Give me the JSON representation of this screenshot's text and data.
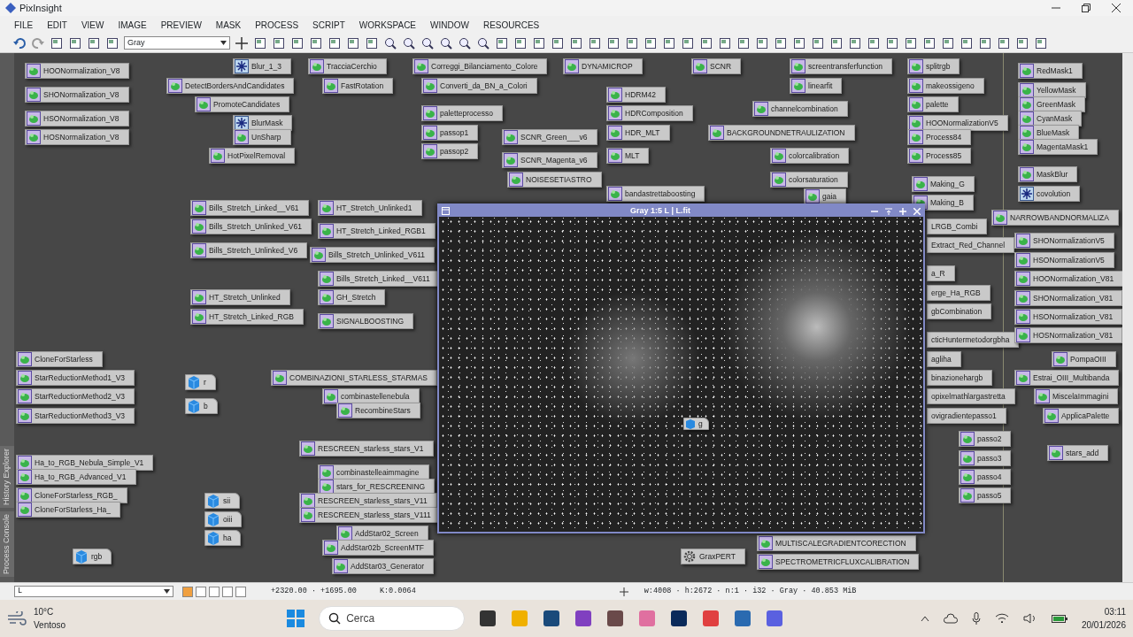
{
  "window": {
    "title": "PixInsight"
  },
  "menu": [
    "FILE",
    "EDIT",
    "VIEW",
    "IMAGE",
    "PREVIEW",
    "MASK",
    "PROCESS",
    "SCRIPT",
    "WORKSPACE",
    "WINDOW",
    "RESOURCES"
  ],
  "toolbar": {
    "view_mode": "Gray"
  },
  "side_tabs": [
    "History Explorer",
    "Process Console"
  ],
  "workspace_icons": [
    {
      "label": "HOONormalization_V8",
      "kind": "process"
    },
    {
      "label": "SHONormalization_V8",
      "kind": "process"
    },
    {
      "label": "HSONormalization_V8",
      "kind": "process"
    },
    {
      "label": "HOSNormalization_V8",
      "kind": "process"
    },
    {
      "label": "Blur_1_3",
      "kind": "star"
    },
    {
      "label": "DetectBordersAndCandidates",
      "kind": "process"
    },
    {
      "label": "PromoteCandidates",
      "kind": "process"
    },
    {
      "label": "BlurMask",
      "kind": "star"
    },
    {
      "label": "UnSharp",
      "kind": "process"
    },
    {
      "label": "HotPixelRemoval",
      "kind": "process"
    },
    {
      "label": "TracciaCerchio",
      "kind": "process"
    },
    {
      "label": "FastRotation",
      "kind": "process"
    },
    {
      "label": "Correggi_Bilanciamento_Colore",
      "kind": "process"
    },
    {
      "label": "Converti_da_BN_a_Colori",
      "kind": "process"
    },
    {
      "label": "paletteprocesso",
      "kind": "process"
    },
    {
      "label": "passop1",
      "kind": "process"
    },
    {
      "label": "passop2",
      "kind": "process"
    },
    {
      "label": "DYNAMICROP",
      "kind": "process"
    },
    {
      "label": "SCNR",
      "kind": "process"
    },
    {
      "label": "HDRM42",
      "kind": "process"
    },
    {
      "label": "HDRComposition",
      "kind": "process"
    },
    {
      "label": "HDR_MLT",
      "kind": "process"
    },
    {
      "label": "MLT",
      "kind": "process"
    },
    {
      "label": "SCNR_Green___v6",
      "kind": "process"
    },
    {
      "label": "SCNR_Magenta_v6",
      "kind": "process"
    },
    {
      "label": "NOISESETIASTRO",
      "kind": "process"
    },
    {
      "label": "bandastrettaboosting",
      "kind": "process"
    },
    {
      "label": "screentransferfunction",
      "kind": "process"
    },
    {
      "label": "linearfit",
      "kind": "process"
    },
    {
      "label": "channelcombination",
      "kind": "process"
    },
    {
      "label": "BACKGROUNDNETRAULIZATION",
      "kind": "process"
    },
    {
      "label": "colorcalibration",
      "kind": "process"
    },
    {
      "label": "colorsaturation",
      "kind": "process"
    },
    {
      "label": "gaia",
      "kind": "process"
    },
    {
      "label": "splitrgb",
      "kind": "process"
    },
    {
      "label": "makeossigeno",
      "kind": "process"
    },
    {
      "label": "palette",
      "kind": "process"
    },
    {
      "label": "HOONormalizationV5",
      "kind": "process"
    },
    {
      "label": "Process84",
      "kind": "process"
    },
    {
      "label": "Process85",
      "kind": "process"
    },
    {
      "label": "Making_G",
      "kind": "process"
    },
    {
      "label": "Making_B",
      "kind": "process"
    },
    {
      "label": "LRGB_Combi",
      "kind": "partial"
    },
    {
      "label": "Extract_Red_Channel",
      "kind": "partial"
    },
    {
      "label": "a_R",
      "kind": "partial"
    },
    {
      "label": "erge_Ha_RGB",
      "kind": "partial"
    },
    {
      "label": "gbCombination",
      "kind": "partial"
    },
    {
      "label": "cticHuntermetodorgbha",
      "kind": "partial"
    },
    {
      "label": "agliha",
      "kind": "partial"
    },
    {
      "label": "binazionehargb",
      "kind": "partial"
    },
    {
      "label": "opixelmathlargastretta",
      "kind": "partial"
    },
    {
      "label": "ovigradientepasso1",
      "kind": "partial"
    },
    {
      "label": "RedMask1",
      "kind": "process"
    },
    {
      "label": "YellowMask",
      "kind": "process"
    },
    {
      "label": "GreenMask",
      "kind": "process"
    },
    {
      "label": "CyanMask",
      "kind": "process"
    },
    {
      "label": "BlueMask",
      "kind": "process"
    },
    {
      "label": "MagentaMask1",
      "kind": "process"
    },
    {
      "label": "MaskBlur",
      "kind": "process"
    },
    {
      "label": "covolution",
      "kind": "star"
    },
    {
      "label": "NARROWBANDNORMALIZA",
      "kind": "process"
    },
    {
      "label": "SHONormalizationV5",
      "kind": "process"
    },
    {
      "label": "HSONormalizationV5",
      "kind": "process"
    },
    {
      "label": "HOONormalization_V81",
      "kind": "process"
    },
    {
      "label": "SHONormalization_V81",
      "kind": "process"
    },
    {
      "label": "HSONormalization_V81",
      "kind": "process"
    },
    {
      "label": "HOSNormalization_V81",
      "kind": "process"
    },
    {
      "label": "PompaOIII",
      "kind": "process"
    },
    {
      "label": "Estrai_OIII_Multibanda",
      "kind": "process"
    },
    {
      "label": "MiscelaImmagini",
      "kind": "process"
    },
    {
      "label": "ApplicaPalette",
      "kind": "process"
    },
    {
      "label": "stars_add",
      "kind": "process"
    },
    {
      "label": "passo2",
      "kind": "process"
    },
    {
      "label": "passo3",
      "kind": "process"
    },
    {
      "label": "passo4",
      "kind": "process"
    },
    {
      "label": "passo5",
      "kind": "process"
    },
    {
      "label": "Bills_Stretch_Linked__V61",
      "kind": "process"
    },
    {
      "label": "Bills_Stretch_Unlinked_V61",
      "kind": "process"
    },
    {
      "label": "Bills_Stretch_Unlinked_V6",
      "kind": "process"
    },
    {
      "label": "HT_Stretch_Unlinked1",
      "kind": "process"
    },
    {
      "label": "HT_Stretch_Linked_RGB1",
      "kind": "process"
    },
    {
      "label": "Bills_Stretch_Unlinked_V611",
      "kind": "process"
    },
    {
      "label": "Bills_Stretch_Linked__V611",
      "kind": "process"
    },
    {
      "label": "GH_Stretch",
      "kind": "process"
    },
    {
      "label": "SIGNALBOOSTING",
      "kind": "process"
    },
    {
      "label": "HT_Stretch_Unlinked",
      "kind": "process"
    },
    {
      "label": "HT_Stretch_Linked_RGB",
      "kind": "process"
    },
    {
      "label": "CloneForStarless",
      "kind": "process"
    },
    {
      "label": "StarReductionMethod1_V3",
      "kind": "process"
    },
    {
      "label": "StarReductionMethod2_V3",
      "kind": "process"
    },
    {
      "label": "StarReductionMethod3_V3",
      "kind": "process"
    },
    {
      "label": "Ha_to_RGB_Nebula_Simple_V1",
      "kind": "process"
    },
    {
      "label": "Ha_to_RGB_Advanced_V1",
      "kind": "process"
    },
    {
      "label": "CloneForStarless_RGB_",
      "kind": "process"
    },
    {
      "label": "CloneForStarless_Ha_",
      "kind": "process"
    },
    {
      "label": "COMBINAZIONI_STARLESS_STARMAS",
      "kind": "process"
    },
    {
      "label": "combinastellenebula",
      "kind": "process"
    },
    {
      "label": "RecombineStars",
      "kind": "process"
    },
    {
      "label": "RESCREEN_starless_stars_V1",
      "kind": "process"
    },
    {
      "label": "combinastelleaimmagine",
      "kind": "process"
    },
    {
      "label": "stars_for_RESCREENING",
      "kind": "process"
    },
    {
      "label": "RESCREEN_starless_stars_V11",
      "kind": "process"
    },
    {
      "label": "RESCREEN_starless_stars_V111",
      "kind": "process"
    },
    {
      "label": "AddStar02_Screen",
      "kind": "process"
    },
    {
      "label": "AddStar02b_ScreenMTF",
      "kind": "process"
    },
    {
      "label": "AddStar03_Generator",
      "kind": "process"
    },
    {
      "label": "r",
      "kind": "image"
    },
    {
      "label": "b",
      "kind": "image"
    },
    {
      "label": "sii",
      "kind": "image"
    },
    {
      "label": "oiii",
      "kind": "image"
    },
    {
      "label": "ha",
      "kind": "image"
    },
    {
      "label": "rgb",
      "kind": "image"
    },
    {
      "label": "MULTISCALEGRADIENTCORECTION",
      "kind": "process"
    },
    {
      "label": "SPECTROMETRICFLUXCALIBRATION",
      "kind": "process"
    },
    {
      "label": "GraxPERT",
      "kind": "gear"
    }
  ],
  "image_window": {
    "title": "Gray 1:5 L | L.fit",
    "icon_label": "g"
  },
  "status_bar": {
    "view": "L",
    "coordinates": "+2320.00 · +1695.00",
    "k": "K:0.0064",
    "info": "w:4008 · h:2672 · n:1 · i32 · Gray · 40.853 MiB"
  },
  "taskbar": {
    "temperature": "10°C",
    "weather": "Ventoso",
    "search_placeholder": "Cerca",
    "time": "03:11",
    "date": "20/01/2026"
  }
}
